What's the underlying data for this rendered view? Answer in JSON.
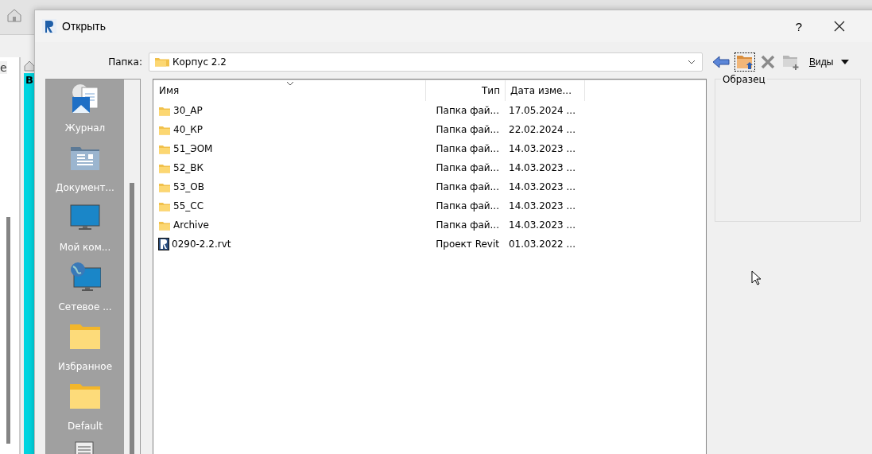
{
  "background_app": {
    "texts": [
      "е",
      "В"
    ]
  },
  "window": {
    "title": "Открыть",
    "help": "?"
  },
  "folder": {
    "label": "Папка:",
    "value": "Корпус 2.2"
  },
  "toolbar": {
    "views": "Виды"
  },
  "places": [
    {
      "kind": "history",
      "label": "Журнал"
    },
    {
      "kind": "documents",
      "label": "Документ..."
    },
    {
      "kind": "computer",
      "label": "Мой ком..."
    },
    {
      "kind": "network",
      "label": "Сетевое ..."
    },
    {
      "kind": "folder",
      "label": "Избранное"
    },
    {
      "kind": "folder",
      "label": "Default"
    },
    {
      "kind": "server"
    }
  ],
  "file_list": {
    "columns": [
      "Имя",
      "Тип",
      "Дата изме..."
    ],
    "rows": [
      {
        "kind": "folder",
        "name": "30_АР",
        "type": "Папка фай...",
        "date": "17.05.2024 ..."
      },
      {
        "kind": "folder",
        "name": "40_КР",
        "type": "Папка фай...",
        "date": "22.02.2024 ..."
      },
      {
        "kind": "folder",
        "name": "51_ЭОМ",
        "type": "Папка фай...",
        "date": "14.03.2023 ..."
      },
      {
        "kind": "folder",
        "name": "52_ВК",
        "type": "Папка фай...",
        "date": "14.03.2023 ..."
      },
      {
        "kind": "folder",
        "name": "53_ОВ",
        "type": "Папка фай...",
        "date": "14.03.2023 ..."
      },
      {
        "kind": "folder",
        "name": "55_СС",
        "type": "Папка фай...",
        "date": "14.03.2023 ..."
      },
      {
        "kind": "folder",
        "name": "Archive",
        "type": "Папка фай...",
        "date": "14.03.2023 ..."
      },
      {
        "kind": "revit",
        "name": "0290-2.2.rvt",
        "type": "Проект Revit",
        "date": "01.03.2022 ..."
      }
    ]
  },
  "preview": {
    "title": "Образец"
  }
}
